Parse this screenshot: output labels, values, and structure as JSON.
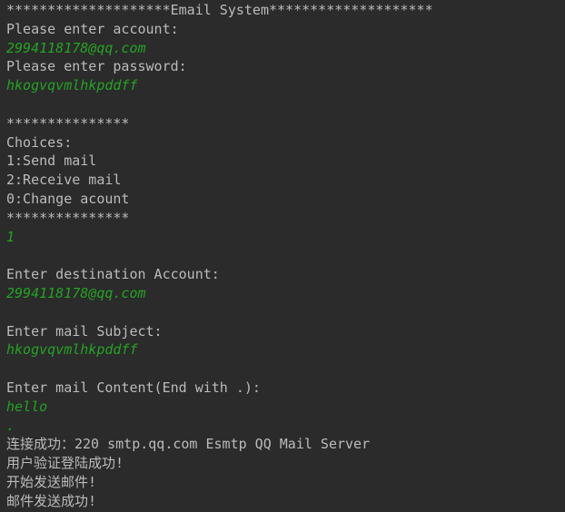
{
  "console": {
    "lines": [
      {
        "text": "********************Email System********************",
        "kind": "output"
      },
      {
        "text": "Please enter account:",
        "kind": "output"
      },
      {
        "text": "2994118178@qq.com",
        "kind": "input"
      },
      {
        "text": "Please enter password:",
        "kind": "output"
      },
      {
        "text": "hkogvqvmlhkpddff",
        "kind": "input"
      },
      {
        "text": "",
        "kind": "blank"
      },
      {
        "text": "***************",
        "kind": "output"
      },
      {
        "text": "Choices:",
        "kind": "output"
      },
      {
        "text": "1:Send mail",
        "kind": "output"
      },
      {
        "text": "2:Receive mail",
        "kind": "output"
      },
      {
        "text": "0:Change acount",
        "kind": "output"
      },
      {
        "text": "***************",
        "kind": "output"
      },
      {
        "text": "1",
        "kind": "input"
      },
      {
        "text": "",
        "kind": "blank"
      },
      {
        "text": "Enter destination Account:",
        "kind": "output"
      },
      {
        "text": "2994118178@qq.com",
        "kind": "input"
      },
      {
        "text": "",
        "kind": "blank"
      },
      {
        "text": "Enter mail Subject:",
        "kind": "output"
      },
      {
        "text": "hkogvqvmlhkpddff",
        "kind": "input"
      },
      {
        "text": "",
        "kind": "blank"
      },
      {
        "text": "Enter mail Content(End with .):",
        "kind": "output"
      },
      {
        "text": "hello",
        "kind": "input"
      },
      {
        "text": ".",
        "kind": "input"
      },
      {
        "text": "连接成功：220 smtp.qq.com Esmtp QQ Mail Server",
        "kind": "output"
      },
      {
        "text": "用户验证登陆成功!",
        "kind": "output"
      },
      {
        "text": "开始发送邮件!",
        "kind": "output"
      },
      {
        "text": "邮件发送成功!",
        "kind": "output"
      }
    ]
  },
  "colors": {
    "background": "#2b2b2b",
    "output_text": "#bbbbbb",
    "input_text": "#23a323"
  }
}
